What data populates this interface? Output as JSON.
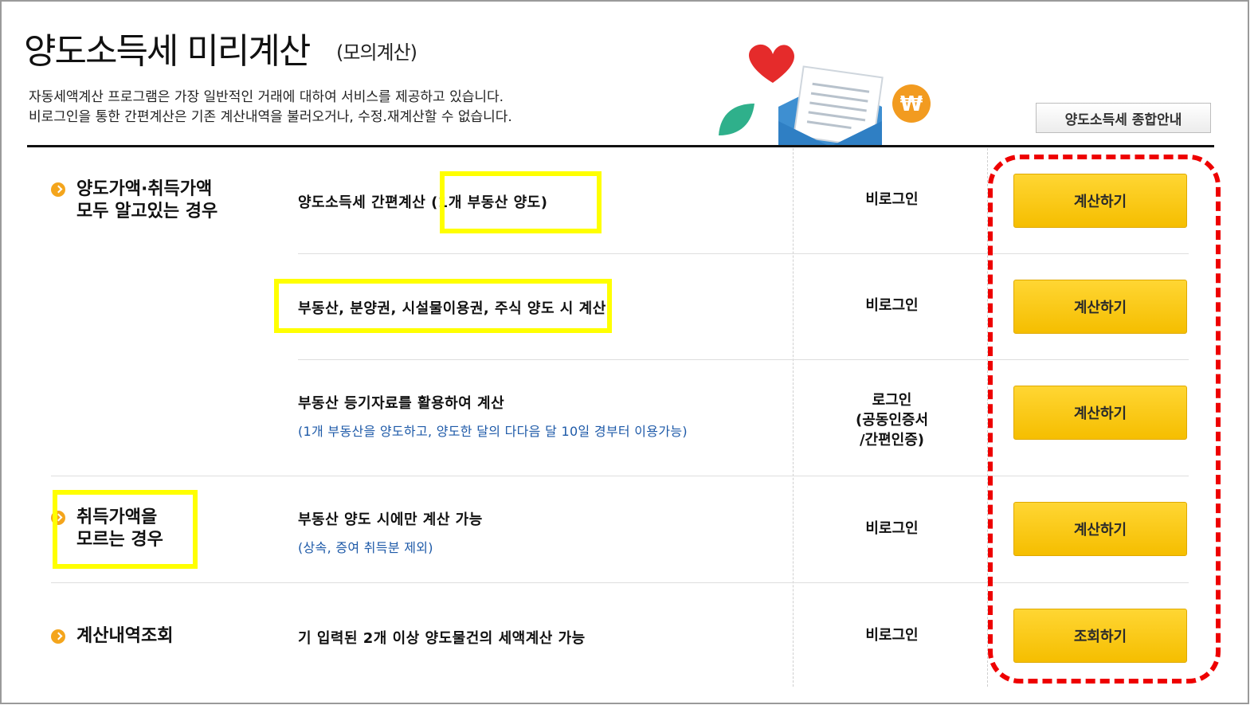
{
  "header": {
    "title": "양도소득세 미리계산",
    "subtitle": "(모의계산)",
    "desc_line1": "자동세액계산 프로그램은 가장 일반적인 거래에 대하여 서비스를 제공하고 있습니다.",
    "desc_line2": "비로그인을 통한 간편계산은 기존 계산내역을 불러오거나, 수정.재계산할 수 없습니다.",
    "guide_button": "양도소득세 종합안내"
  },
  "categories": {
    "both_known_line1": "양도가액·취득가액",
    "both_known_line2": "모두 알고있는 경우",
    "unknown_line1": "취득가액을",
    "unknown_line2": "모르는 경우",
    "history": "계산내역조회"
  },
  "rows": [
    {
      "main": "양도소득세 간편계산 (1개 부동산 양도)",
      "sub": "",
      "login": "비로그인",
      "button": "계산하기"
    },
    {
      "main": "부동산, 분양권, 시설물이용권, 주식 양도 시 계산",
      "sub": "",
      "login": "비로그인",
      "button": "계산하기"
    },
    {
      "main": "부동산 등기자료를 활용하여 계산",
      "sub": "(1개 부동산을 양도하고, 양도한 달의 다다음 달 10일 경부터 이용가능)",
      "login_line1": "로그인",
      "login_line2": "(공동인증서",
      "login_line3": "/간편인증)",
      "button": "계산하기"
    },
    {
      "main": "부동산 양도 시에만 계산 가능",
      "sub": "(상속, 증여 취득분 제외)",
      "login": "비로그인",
      "button": "계산하기"
    },
    {
      "main": "기 입력된 2개 이상 양도물건의 세액계산 가능",
      "sub": "",
      "login": "비로그인",
      "button": "조회하기"
    }
  ],
  "colors": {
    "button_yellow": "#f5be00",
    "highlight_yellow": "#ffff00",
    "annotation_red": "#ee0000",
    "sub_blue": "#1e5aa8",
    "bullet_orange": "#f4a51c"
  }
}
